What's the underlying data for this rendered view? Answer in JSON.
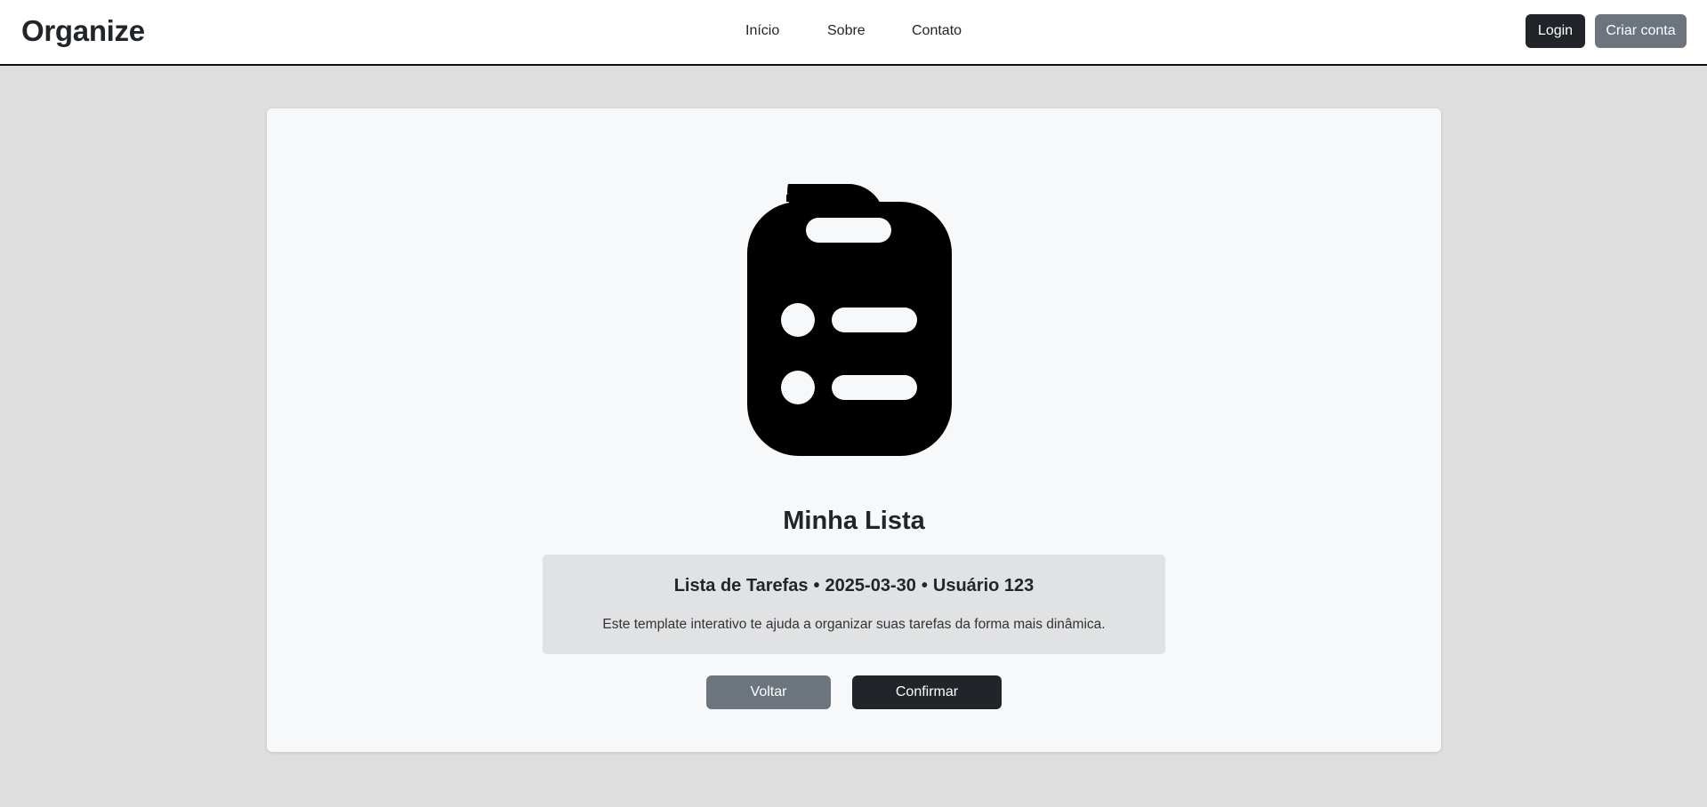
{
  "header": {
    "brand": "Organize",
    "nav": [
      {
        "label": "Início"
      },
      {
        "label": "Sobre"
      },
      {
        "label": "Contato"
      }
    ],
    "login_label": "Login",
    "signup_label": "Criar conta"
  },
  "card": {
    "icon": "clipboard-list-icon",
    "title": "Minha Lista",
    "info": {
      "list_name": "Lista de Tarefas",
      "date": "2025-03-30",
      "user": "Usuário 123",
      "separator": "•",
      "description": "Este template interativo te ajuda a organizar suas tarefas da forma mais dinâmica."
    },
    "back_label": "Voltar",
    "confirm_label": "Confirmar"
  },
  "colors": {
    "page_background": "#dedede",
    "card_background": "#f7f8fa",
    "info_background": "#e1e2e4",
    "dark_button": "#212529",
    "grey_button": "#6c757d"
  }
}
